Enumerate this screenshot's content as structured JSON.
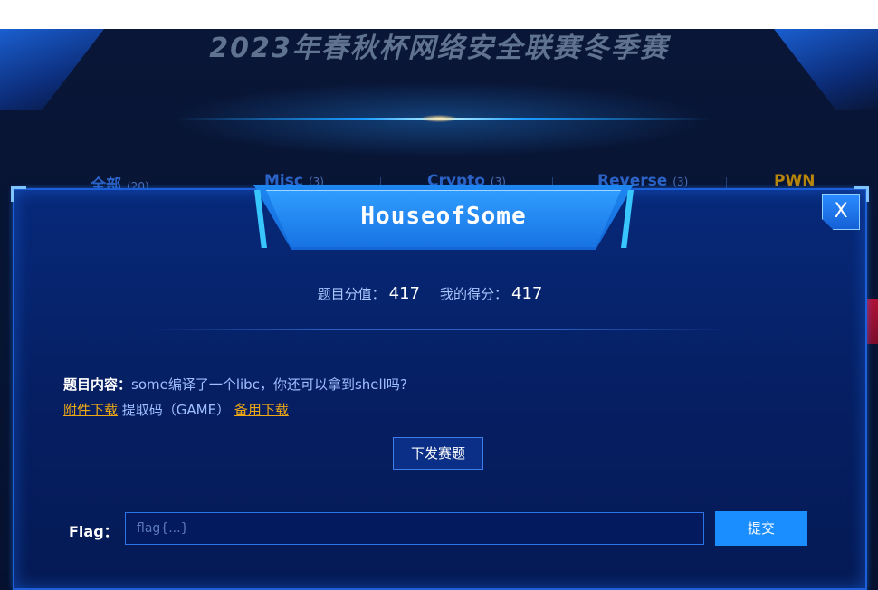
{
  "event": {
    "title": "2023年春秋杯网络安全联赛冬季赛"
  },
  "tabs": [
    {
      "label": "全部",
      "count": "(20)"
    },
    {
      "label": "Misc",
      "count": "(3)"
    },
    {
      "label": "Crypto",
      "count": "(3)"
    },
    {
      "label": "Reverse",
      "count": "(3)"
    },
    {
      "label": "PWN",
      "count": ""
    }
  ],
  "modal": {
    "title": "HouseofSome",
    "close_label": "X",
    "score_label": "题目分值：",
    "score_value": "417",
    "my_score_label": "我的得分：",
    "my_score_value": "417",
    "content_label": "题目内容：",
    "content_text": "some编译了一个libc，你还可以拿到shell吗?",
    "attachment_link": "附件下载",
    "extract_code": " 提取码（GAME）",
    "backup_link": "备用下载",
    "deploy_button": "下发赛题",
    "flag_label": "Flag：",
    "flag_placeholder": "flag{...}",
    "submit_button": "提交"
  },
  "colors": {
    "accent": "#1a8dff",
    "link": "#f0a914",
    "modal_bg": "#06226b"
  }
}
